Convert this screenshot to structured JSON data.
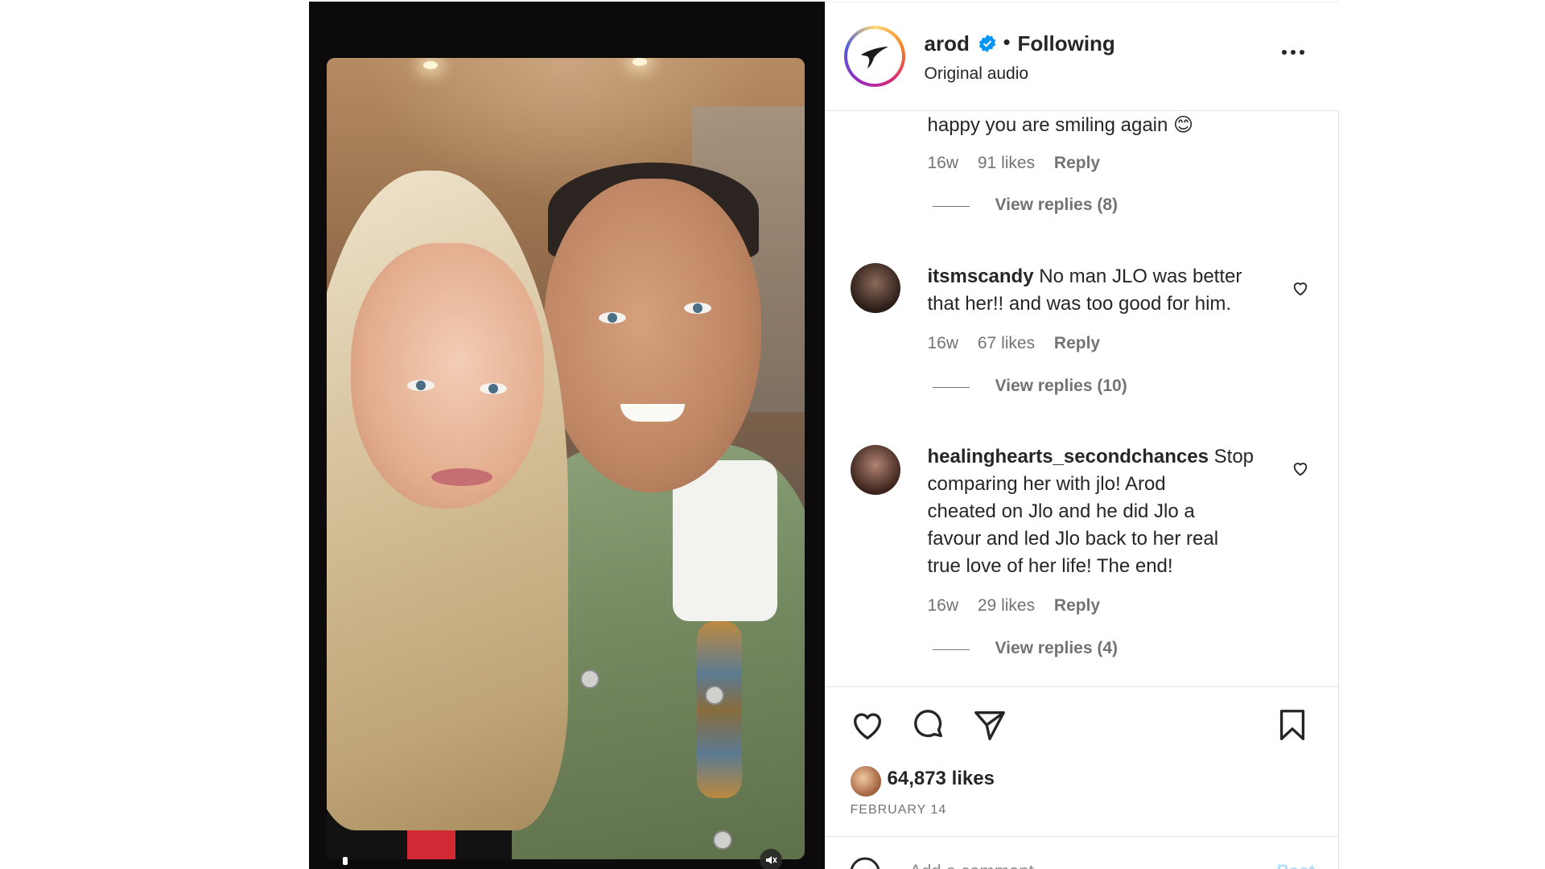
{
  "header": {
    "username": "arod",
    "separator": "•",
    "follow_status": "Following",
    "audio": "Original audio"
  },
  "comments": [
    {
      "username": "",
      "text": "happy you are smiling again 😊",
      "time": "16w",
      "likes": "91 likes",
      "reply": "Reply",
      "view_replies": "View replies (8)"
    },
    {
      "username": "itsmscandy",
      "text_line1": "No man JLO was better",
      "text_line2": "that her!! and was too good for him.",
      "time": "16w",
      "likes": "67 likes",
      "reply": "Reply",
      "view_replies": "View replies (10)"
    },
    {
      "username": "healinghearts_secondchances",
      "text_line1": "Stop",
      "text_line2": "comparing her with jlo! Arod",
      "text_line3": "cheated on Jlo and he did Jlo a",
      "text_line4": "favour and led Jlo back to her real",
      "text_line5": "true love of her life! The end!",
      "time": "16w",
      "likes": "29 likes",
      "reply": "Reply",
      "view_replies": "View replies (4)"
    }
  ],
  "actions": {
    "likes": "64,873 likes",
    "date": "FEBRUARY 14"
  },
  "comment_box": {
    "placeholder": "Add a comment…",
    "post_label": "Post"
  },
  "icons": [
    "verified-icon",
    "more-icon",
    "heart-icon",
    "comment-icon",
    "share-icon",
    "bookmark-icon",
    "emoji-icon",
    "mute-icon"
  ],
  "colors": {
    "verified": "#0095f6",
    "muted_text": "#737373",
    "post_button": "#b2dffc"
  }
}
